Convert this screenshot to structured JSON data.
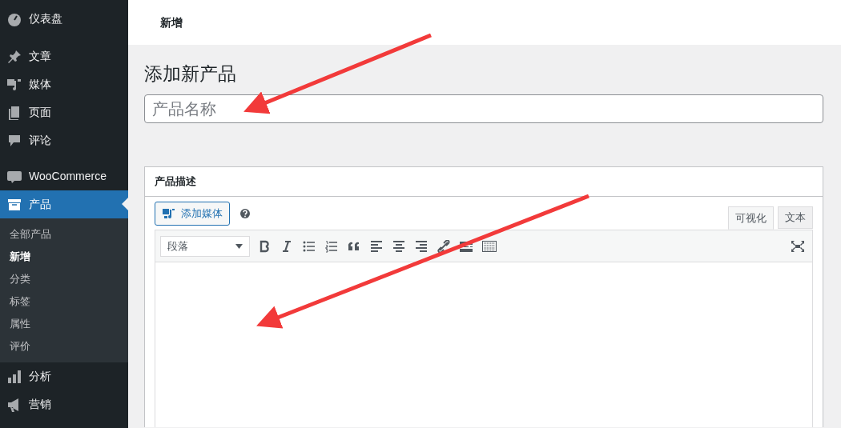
{
  "sidebar": {
    "items": [
      {
        "kind": "dashboard",
        "label": "仪表盘",
        "selected": false
      },
      {
        "kind": "pin",
        "label": "文章",
        "selected": false
      },
      {
        "kind": "media",
        "label": "媒体",
        "selected": false
      },
      {
        "kind": "pages",
        "label": "页面",
        "selected": false
      },
      {
        "kind": "comments",
        "label": "评论",
        "selected": false
      },
      {
        "kind": "woo",
        "label": "WooCommerce",
        "selected": false
      },
      {
        "kind": "products",
        "label": "产品",
        "selected": true,
        "children": [
          {
            "label": "全部产品",
            "selected": false
          },
          {
            "label": "新增",
            "selected": true
          },
          {
            "label": "分类",
            "selected": false
          },
          {
            "label": "标签",
            "selected": false
          },
          {
            "label": "属性",
            "selected": false
          },
          {
            "label": "评价",
            "selected": false
          }
        ]
      },
      {
        "kind": "analytics",
        "label": "分析",
        "selected": false
      },
      {
        "kind": "marketing",
        "label": "营销",
        "selected": false
      }
    ]
  },
  "header": {
    "title": "新增"
  },
  "page_title": "添加新产品",
  "title_field": {
    "placeholder": "产品名称"
  },
  "description_box": {
    "title": "产品描述",
    "add_media_button": "添加媒体",
    "editor_tabs": [
      {
        "label": "可视化",
        "selected": true
      },
      {
        "label": "文本",
        "selected": false
      }
    ],
    "format_select": "段落"
  }
}
